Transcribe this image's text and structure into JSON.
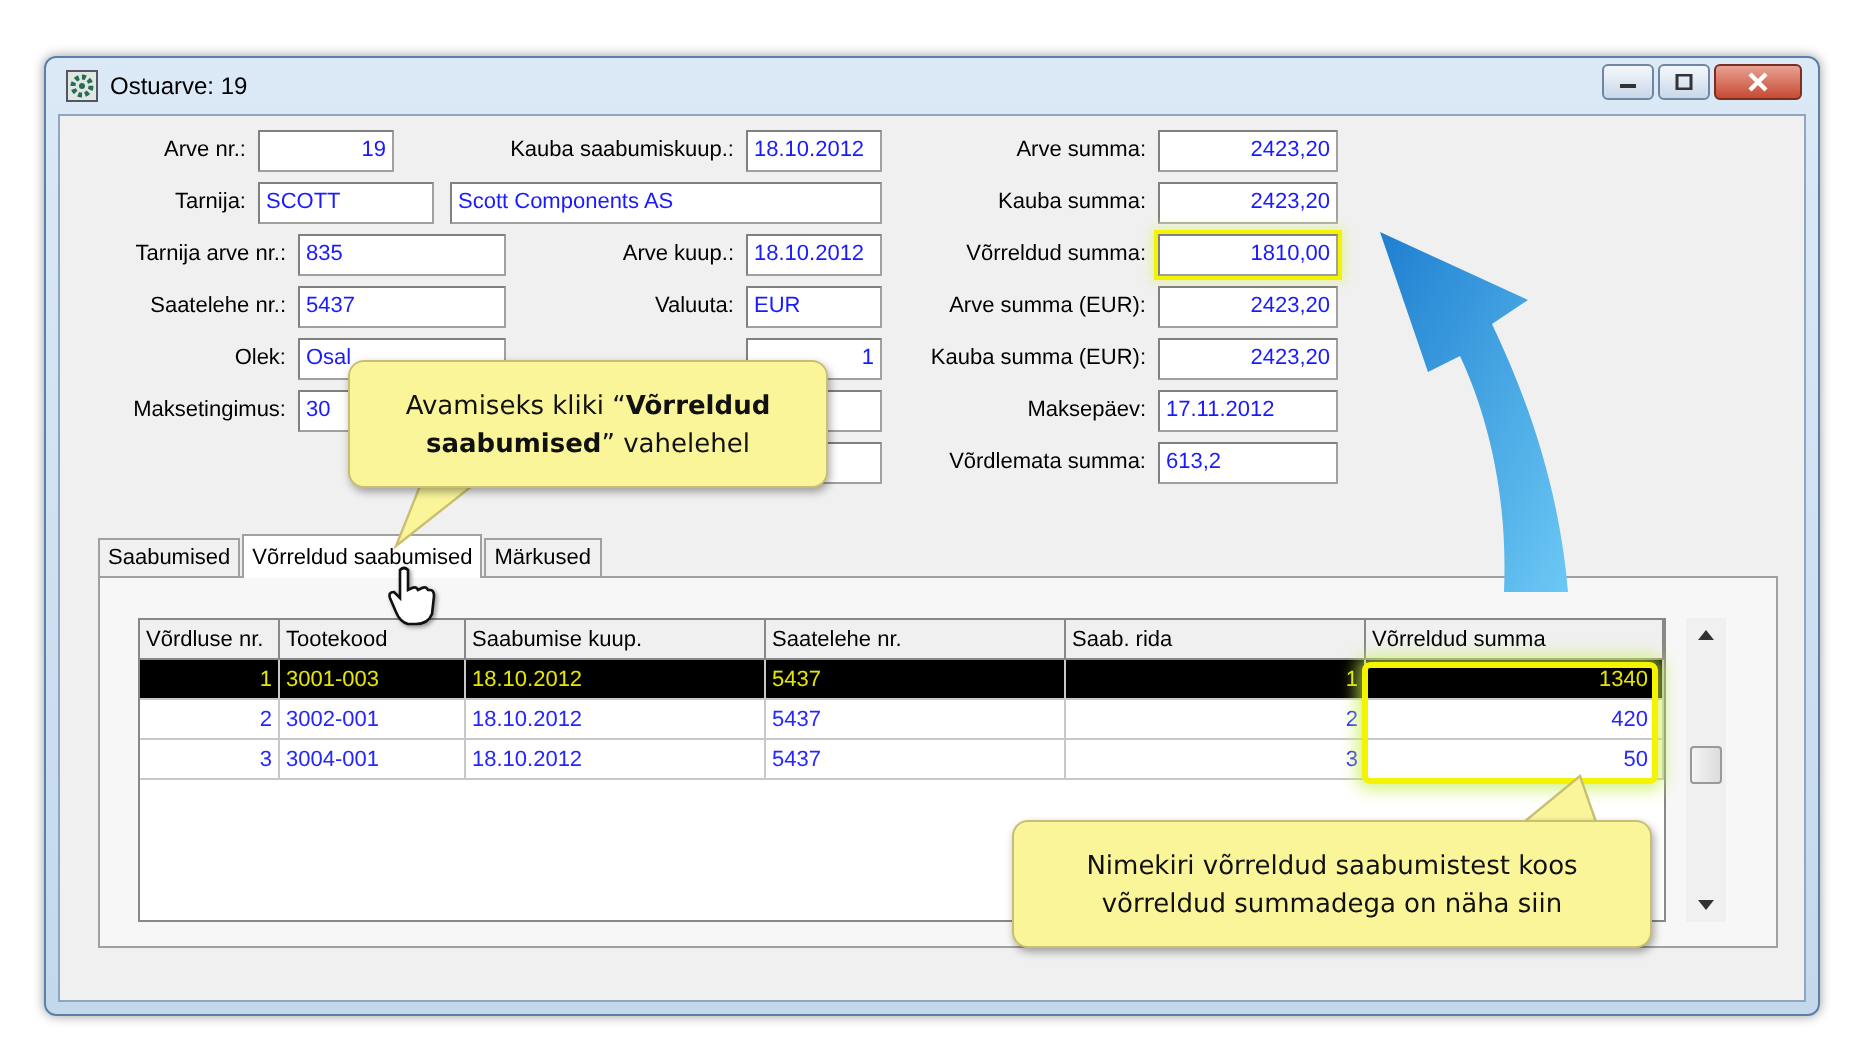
{
  "window": {
    "title": "Ostuarve: 19"
  },
  "form": {
    "rows": [
      [
        {
          "kind": "label",
          "text": "Arve nr.:"
        },
        {
          "kind": "number-field",
          "value": "19"
        },
        {
          "kind": "label",
          "text": "Kauba saabumiskuup.:"
        },
        {
          "kind": "field",
          "value": "18.10.2012"
        },
        {
          "kind": "label",
          "text": "Arve summa:"
        },
        {
          "kind": "number-field",
          "value": "2423,20"
        }
      ],
      [
        {
          "kind": "label",
          "text": "Tarnija:"
        },
        {
          "kind": "field",
          "value": "SCOTT"
        },
        {
          "kind": "field",
          "value": "Scott Components AS"
        },
        {
          "kind": "label",
          "text": "Kauba summa:"
        },
        {
          "kind": "number-field",
          "value": "2423,20"
        }
      ],
      [
        {
          "kind": "label",
          "text": "Tarnija arve nr.:"
        },
        {
          "kind": "field",
          "value": "835"
        },
        {
          "kind": "label",
          "text": "Arve kuup.:"
        },
        {
          "kind": "field",
          "value": "18.10.2012"
        },
        {
          "kind": "label",
          "text": "Võrreldud summa:"
        },
        {
          "kind": "number-field",
          "value": "1810,00",
          "highlighted": true
        }
      ],
      [
        {
          "kind": "label",
          "text": "Saatelehe nr.:"
        },
        {
          "kind": "field",
          "value": "5437"
        },
        {
          "kind": "label",
          "text": "Valuuta:"
        },
        {
          "kind": "field",
          "value": "EUR"
        },
        {
          "kind": "label",
          "text": "Arve summa (EUR):"
        },
        {
          "kind": "number-field",
          "value": "2423,20"
        }
      ],
      [
        {
          "kind": "label",
          "text": "Olek:"
        },
        {
          "kind": "field",
          "value": "Osal"
        },
        {
          "kind": "number-field",
          "value": "1"
        },
        {
          "kind": "label",
          "text": "Kauba summa (EUR):"
        },
        {
          "kind": "number-field",
          "value": "2423,20"
        }
      ],
      [
        {
          "kind": "label",
          "text": "Maksetingimus:"
        },
        {
          "kind": "field",
          "value": "30"
        },
        {
          "kind": "field"
        },
        {
          "kind": "label",
          "text": "Maksepäev:"
        },
        {
          "kind": "field",
          "value": "17.11.2012"
        }
      ],
      [
        {
          "kind": "field"
        },
        {
          "kind": "label",
          "text": "Võrdlemata summa:"
        },
        {
          "kind": "field",
          "value": "613,2"
        }
      ]
    ]
  },
  "tabs": [
    {
      "label": "Saabumised",
      "selected": false
    },
    {
      "label": "Võrreldud saabumised",
      "selected": true
    },
    {
      "label": "Märkused",
      "selected": false
    }
  ],
  "table": {
    "columns": [
      {
        "title": "Võrdluse nr.",
        "kind": "number"
      },
      {
        "title": "Tootekood",
        "kind": "text"
      },
      {
        "title": "Saabumise kuup.",
        "kind": "text"
      },
      {
        "title": "Saatelehe nr.",
        "kind": "text"
      },
      {
        "title": "Saab. rida",
        "kind": "number"
      },
      {
        "title": "Võrreldud summa",
        "kind": "number",
        "highlighted": true
      }
    ],
    "rows": [
      {
        "selected": true,
        "cells": [
          "1",
          "3001-003",
          "18.10.2012",
          "5437",
          "1",
          "1340"
        ]
      },
      {
        "selected": false,
        "cells": [
          "2",
          "3002-001",
          "18.10.2012",
          "5437",
          "2",
          "420"
        ]
      },
      {
        "selected": false,
        "cells": [
          "3",
          "3004-001",
          "18.10.2012",
          "5437",
          "3",
          "50"
        ]
      }
    ]
  },
  "callouts": [
    {
      "text": "Avamiseks kliki “**Võrreldud saabumised**” vahelehel"
    },
    {
      "text": "Nimekiri võrreldud saabumistest koos võrreldud summadega on näha siin"
    }
  ]
}
